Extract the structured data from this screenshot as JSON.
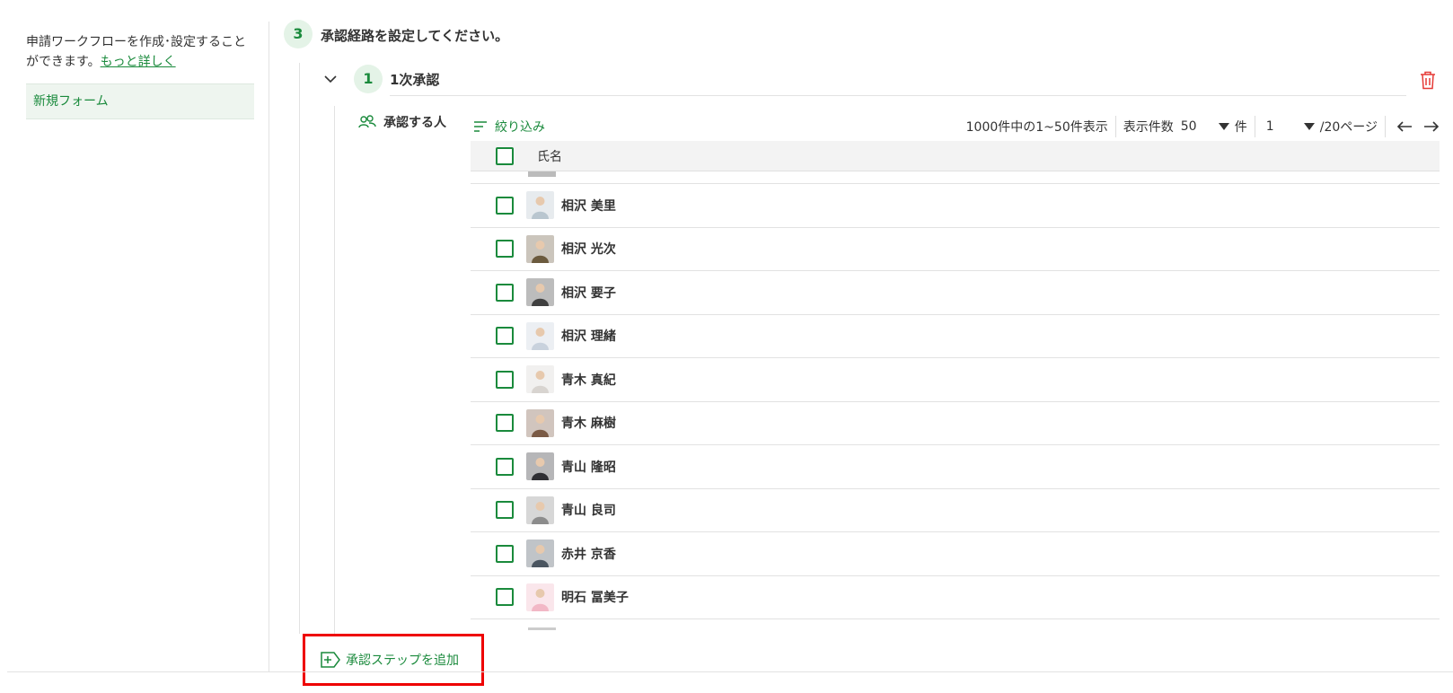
{
  "sidebar": {
    "description": "申請ワークフローを作成･設定することができます。",
    "more_link": "もっと詳しく",
    "items": [
      {
        "label": "新規フォーム"
      }
    ]
  },
  "step": {
    "number": "3",
    "title": "承認経路を設定してください。"
  },
  "substep": {
    "number": "1",
    "title": "1次承認"
  },
  "approver_label": "承認する人",
  "toolbar": {
    "filter_label": "絞り込み",
    "count_text": "1000件中の1~50件表示",
    "per_page_label": "表示件数",
    "per_page_value": "50",
    "per_page_unit": "件",
    "page_value": "1",
    "page_total": "/20ページ"
  },
  "table": {
    "header_name": "氏名",
    "rows": [
      {
        "name": "相沢 美里",
        "avatar": "photo-1"
      },
      {
        "name": "相沢 光次",
        "avatar": "photo-2"
      },
      {
        "name": "相沢 要子",
        "avatar": "photo-3"
      },
      {
        "name": "相沢 理緒",
        "avatar": "photo-4"
      },
      {
        "name": "青木 真紀",
        "avatar": "photo-5"
      },
      {
        "name": "青木 麻樹",
        "avatar": "photo-6"
      },
      {
        "name": "青山 隆昭",
        "avatar": "photo-7"
      },
      {
        "name": "青山 良司",
        "avatar": "photo-8"
      },
      {
        "name": "赤井 京香",
        "avatar": "photo-9"
      },
      {
        "name": "明石 冨美子",
        "avatar": "photo-10"
      }
    ]
  },
  "add_step_label": "承認ステップを追加",
  "colors": {
    "accent": "#1a8a3c",
    "danger": "#e53935",
    "highlight": "#ee0000"
  }
}
